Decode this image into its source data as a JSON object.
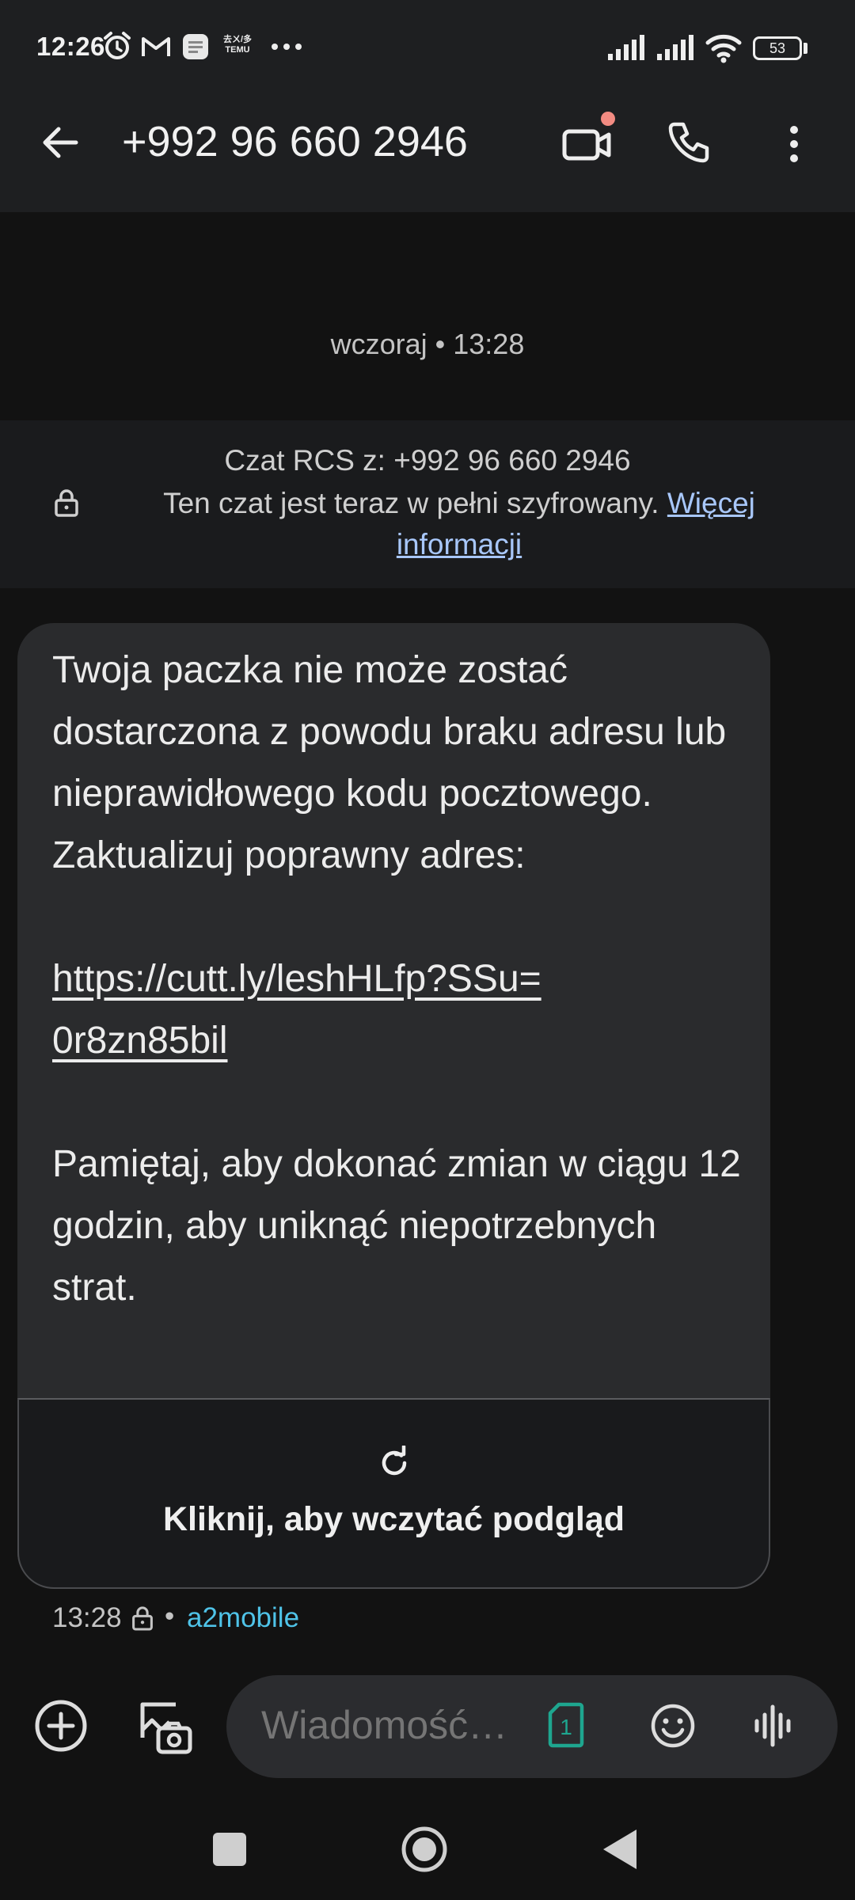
{
  "status_bar": {
    "time": "12:26",
    "battery": "53",
    "icons": [
      "alarm-icon",
      "gmail-icon",
      "app-icon",
      "temu-icon",
      "more-dots-icon",
      "signal-icon",
      "signal-icon",
      "wifi-icon",
      "battery-icon"
    ],
    "temu_label_top": "去ㄨ/多",
    "temu_label_bottom": "TEMU"
  },
  "app_bar": {
    "back_icon": "arrow-back-icon",
    "title": "+992 96 660 2946",
    "video_icon": "video-call-icon",
    "call_icon": "phone-icon",
    "menu_icon": "more-vert-icon"
  },
  "conversation": {
    "date_stamp": "wczoraj • 13:28",
    "rcs_banner": {
      "line1": "Czat RCS z: +992 96 660 2946",
      "line2_text": "Ten czat jest teraz w pełni szyfrowany. ",
      "line2_link": "Więcej informacji"
    },
    "message": {
      "paragraph1": "Twoja paczka nie może zostać dostarczona z powodu braku adresu lub nieprawidłowego kodu pocztowego. Zaktualizuj poprawny adres:",
      "link_part1": "https://cutt.ly/leshHLfp?SSu=",
      "link_part2": "0r8zn85bil",
      "paragraph2": "Pamiętaj, aby dokonać zmian w ciągu 12 godzin, aby uniknąć niepotrzebnych strat.",
      "preview_label": "Kliknij, aby wczytać podgląd",
      "time": "13:28",
      "separator": "•",
      "carrier": "a2mobile"
    }
  },
  "compose": {
    "placeholder": "Wiadomość…",
    "sim_label": "1",
    "accent_color": "#1ea68f"
  },
  "colors": {
    "background": "#121212",
    "bar": "#1e1f21",
    "bubble": "#2a2b2d",
    "link": "#a8c7fa",
    "carrier": "#4fc3e8",
    "notification_dot": "#f28b82"
  }
}
